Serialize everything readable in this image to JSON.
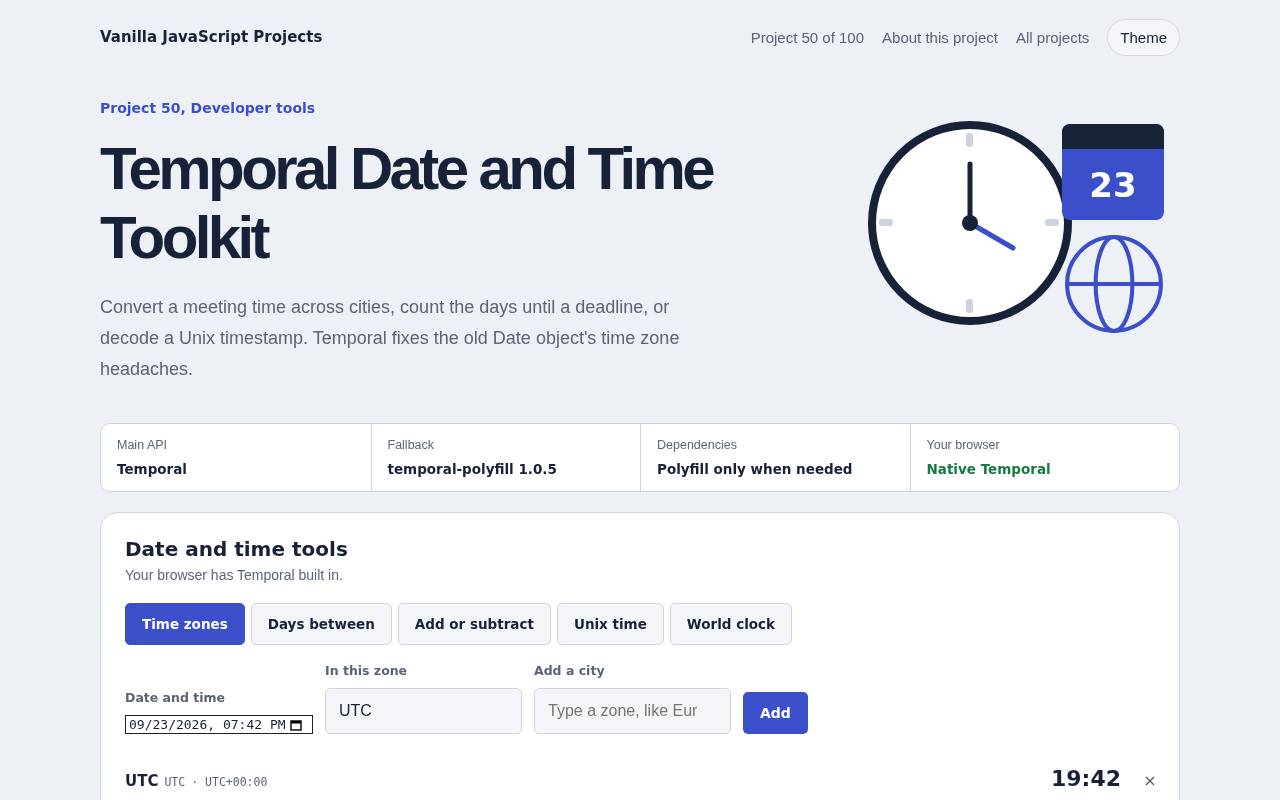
{
  "header": {
    "brand": "Vanilla JavaScript Projects",
    "nav": [
      {
        "label": "Project 50 of 100"
      },
      {
        "label": "About this project"
      },
      {
        "label": "All projects"
      }
    ],
    "theme_button": "Theme"
  },
  "hero": {
    "eyebrow": "Project 50, Developer tools",
    "title": "Temporal Date and Time Toolkit",
    "intro": "Convert a meeting time across cities, count the days until a deadline, or decode a Unix timestamp. Temporal fixes the old Date object's time zone headaches.",
    "calendar_day": "23"
  },
  "facts": [
    {
      "label": "Main API",
      "value": "Temporal",
      "color": "#172239"
    },
    {
      "label": "Fallback",
      "value": "temporal-polyfill 1.0.5",
      "color": "#172239"
    },
    {
      "label": "Dependencies",
      "value": "Polyfill only when needed",
      "color": "#172239"
    },
    {
      "label": "Your browser",
      "value": "Native Temporal",
      "color": "#157a43"
    }
  ],
  "tools": {
    "title": "Date and time tools",
    "subtitle": "Your browser has Temporal built in.",
    "tabs": [
      {
        "label": "Time zones",
        "selected": true
      },
      {
        "label": "Days between",
        "selected": false
      },
      {
        "label": "Add or subtract",
        "selected": false
      },
      {
        "label": "Unix time",
        "selected": false
      },
      {
        "label": "World clock",
        "selected": false
      }
    ],
    "date_field": {
      "label": "Date and time",
      "value": "09/23/2026, 07:42 PM"
    },
    "zone_field": {
      "label": "In this zone",
      "value": "UTC"
    },
    "city_field": {
      "label": "Add a city",
      "placeholder": "Type a zone, like Eur"
    },
    "add_button": "Add",
    "zones": [
      {
        "name": "UTC",
        "code": "UTC",
        "offset": "· UTC+00:00",
        "time": "19:42"
      }
    ]
  }
}
